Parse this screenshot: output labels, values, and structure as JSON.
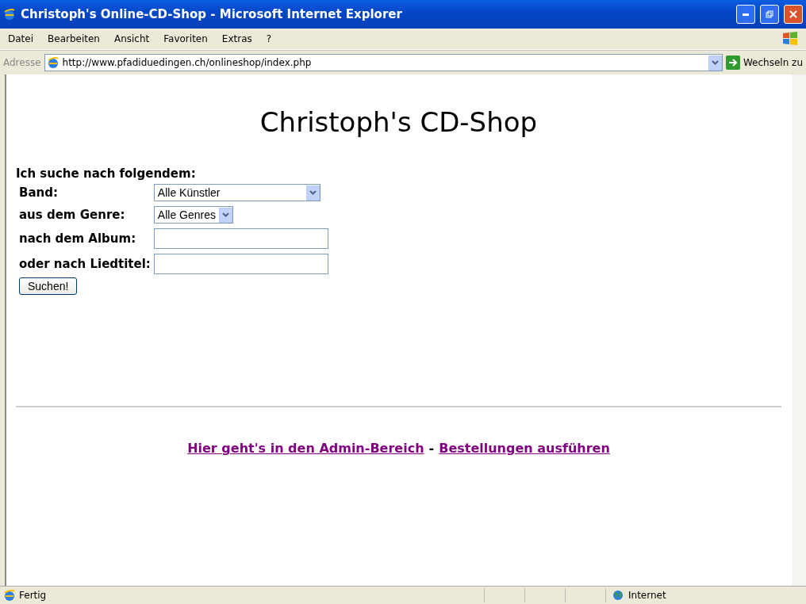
{
  "window": {
    "title": "Christoph's Online-CD-Shop - Microsoft Internet Explorer"
  },
  "menu": [
    "Datei",
    "Bearbeiten",
    "Ansicht",
    "Favoriten",
    "Extras",
    "?"
  ],
  "address_bar": {
    "label": "Adresse",
    "url": "http://www.pfadiduedingen.ch/onlineshop/index.php",
    "go": "Wechseln zu"
  },
  "page": {
    "heading": "Christoph's CD-Shop",
    "intro": "Ich suche nach folgendem:",
    "fields": [
      {
        "kind": "select",
        "label": "Band:",
        "value": "Alle Künstler",
        "wide": true
      },
      {
        "kind": "select",
        "label": "aus dem Genre:",
        "value": "Alle Genres",
        "wide": false
      },
      {
        "kind": "text",
        "label": "nach dem Album:"
      },
      {
        "kind": "text",
        "label": "oder nach Liedtitel:"
      }
    ],
    "button": "Suchen!",
    "footer": {
      "links": [
        "Hier geht's in den Admin-Bereich",
        "Bestellungen ausführen"
      ],
      "separator": "-"
    }
  },
  "status_bar": {
    "text": "Fertig",
    "zone": "Internet"
  }
}
